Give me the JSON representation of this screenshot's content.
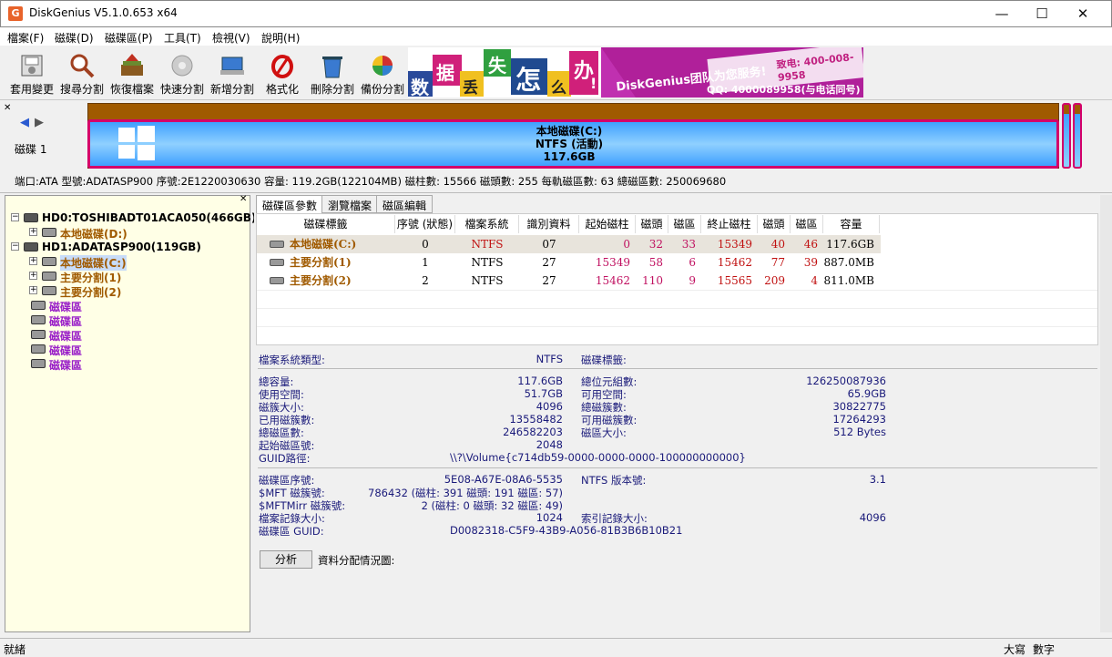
{
  "window": {
    "title": "DiskGenius V5.1.0.653 x64"
  },
  "menu": [
    "檔案(F)",
    "磁碟(D)",
    "磁碟區(P)",
    "工具(T)",
    "檢視(V)",
    "說明(H)"
  ],
  "toolbar": [
    {
      "label": "套用變更",
      "icon": "save-icon"
    },
    {
      "label": "搜尋分割",
      "icon": "search-icon"
    },
    {
      "label": "恢復檔案",
      "icon": "recover-icon"
    },
    {
      "label": "快速分割",
      "icon": "quick-partition-icon"
    },
    {
      "label": "新增分割",
      "icon": "new-partition-icon"
    },
    {
      "label": "格式化",
      "icon": "format-icon"
    },
    {
      "label": "刪除分割",
      "icon": "delete-icon"
    },
    {
      "label": "備份分割",
      "icon": "backup-icon"
    }
  ],
  "banner": {
    "chars": [
      "数",
      "据",
      "丢",
      "失",
      "怎",
      "么",
      "办",
      "!"
    ],
    "team": "DiskGenius团队为您服务!",
    "phone": "致电: 400-008-9958",
    "qq": "QQ: 4000089958(与电话同号)"
  },
  "diskbar": {
    "disk_label": "磁碟 1",
    "part_name": "本地磁碟(C:)",
    "part_fs": "NTFS (活動)",
    "part_size": "117.6GB",
    "info": "端口:ATA  型號:ADATASP900  序號:2E1220030630  容量: 119.2GB(122104MB)  磁柱數: 15566  磁頭數: 255  每軌磁區數: 63  總磁區數: 250069680"
  },
  "tree": [
    {
      "label": "HD0:TOSHIBADT01ACA050(466GB)",
      "color": "#000"
    },
    {
      "label": "本地磁碟(D:)",
      "color": "#a05a00"
    },
    {
      "label": "HD1:ADATASP900(119GB)",
      "color": "#000"
    },
    {
      "label": "本地磁碟(C:)",
      "color": "#a05a00"
    },
    {
      "label": "主要分割(1)",
      "color": "#a05a00"
    },
    {
      "label": "主要分割(2)",
      "color": "#a05a00"
    },
    {
      "label": "磁碟區",
      "color": "#9a20c8"
    },
    {
      "label": "磁碟區",
      "color": "#9a20c8"
    },
    {
      "label": "磁碟區",
      "color": "#9a20c8"
    },
    {
      "label": "磁碟區",
      "color": "#9a20c8"
    },
    {
      "label": "磁碟區",
      "color": "#9a20c8"
    }
  ],
  "tabs": [
    "磁碟區參數",
    "瀏覽檔案",
    "磁區編輯"
  ],
  "table": {
    "headers": [
      "磁碟標籤",
      "序號 (狀態)",
      "檔案系統",
      "識別資料",
      "起始磁柱",
      "磁頭",
      "磁區",
      "終止磁柱",
      "磁頭",
      "磁區",
      "容量"
    ],
    "rows": [
      [
        "本地磁碟(C:)",
        "0",
        "NTFS",
        "07",
        "0",
        "32",
        "33",
        "15349",
        "40",
        "46",
        "117.6GB"
      ],
      [
        "主要分割(1)",
        "1",
        "NTFS",
        "27",
        "15349",
        "58",
        "6",
        "15462",
        "77",
        "39",
        "887.0MB"
      ],
      [
        "主要分割(2)",
        "2",
        "NTFS",
        "27",
        "15462",
        "110",
        "9",
        "15565",
        "209",
        "4",
        "811.0MB"
      ]
    ]
  },
  "details": {
    "fs_type_label": "檔案系統類型:",
    "fs_type": "NTFS",
    "vol_label_label": "磁碟標籤:",
    "left1": [
      [
        "總容量:",
        "117.6GB"
      ],
      [
        "使用空間:",
        "51.7GB"
      ],
      [
        "磁簇大小:",
        "4096"
      ],
      [
        "已用磁簇數:",
        "13558482"
      ],
      [
        "總磁區數:",
        "246582203"
      ],
      [
        "起始磁區號:",
        "2048"
      ]
    ],
    "right1": [
      [
        "總位元組數:",
        "126250087936"
      ],
      [
        "可用空間:",
        "65.9GB"
      ],
      [
        "總磁簇數:",
        "30822775"
      ],
      [
        "可用磁簇數:",
        "17264293"
      ],
      [
        "磁區大小:",
        "512 Bytes"
      ]
    ],
    "guid_label": "GUID路徑:",
    "guid": "\\\\?\\Volume{c714db59-0000-0000-0000-100000000000}",
    "left2": [
      [
        "磁碟區序號:",
        "5E08-A67E-08A6-5535"
      ],
      [
        "$MFT 磁簇號:",
        "786432 (磁柱: 391 磁頭: 191 磁區: 57)"
      ],
      [
        "$MFTMirr 磁簇號:",
        "2 (磁柱: 0 磁頭: 32 磁區: 49)"
      ],
      [
        "檔案記錄大小:",
        "1024"
      ],
      [
        "磁碟區 GUID:",
        "D0082318-C5F9-43B9-A056-81B3B6B10B21"
      ]
    ],
    "right2": [
      [
        "NTFS 版本號:",
        "3.1"
      ],
      [
        "索引記錄大小:",
        "4096"
      ]
    ],
    "analyze": "分析",
    "alloc_label": "資料分配情況圖:"
  },
  "status": {
    "left": "就緒",
    "caps": "大寫",
    "num": "數字"
  }
}
